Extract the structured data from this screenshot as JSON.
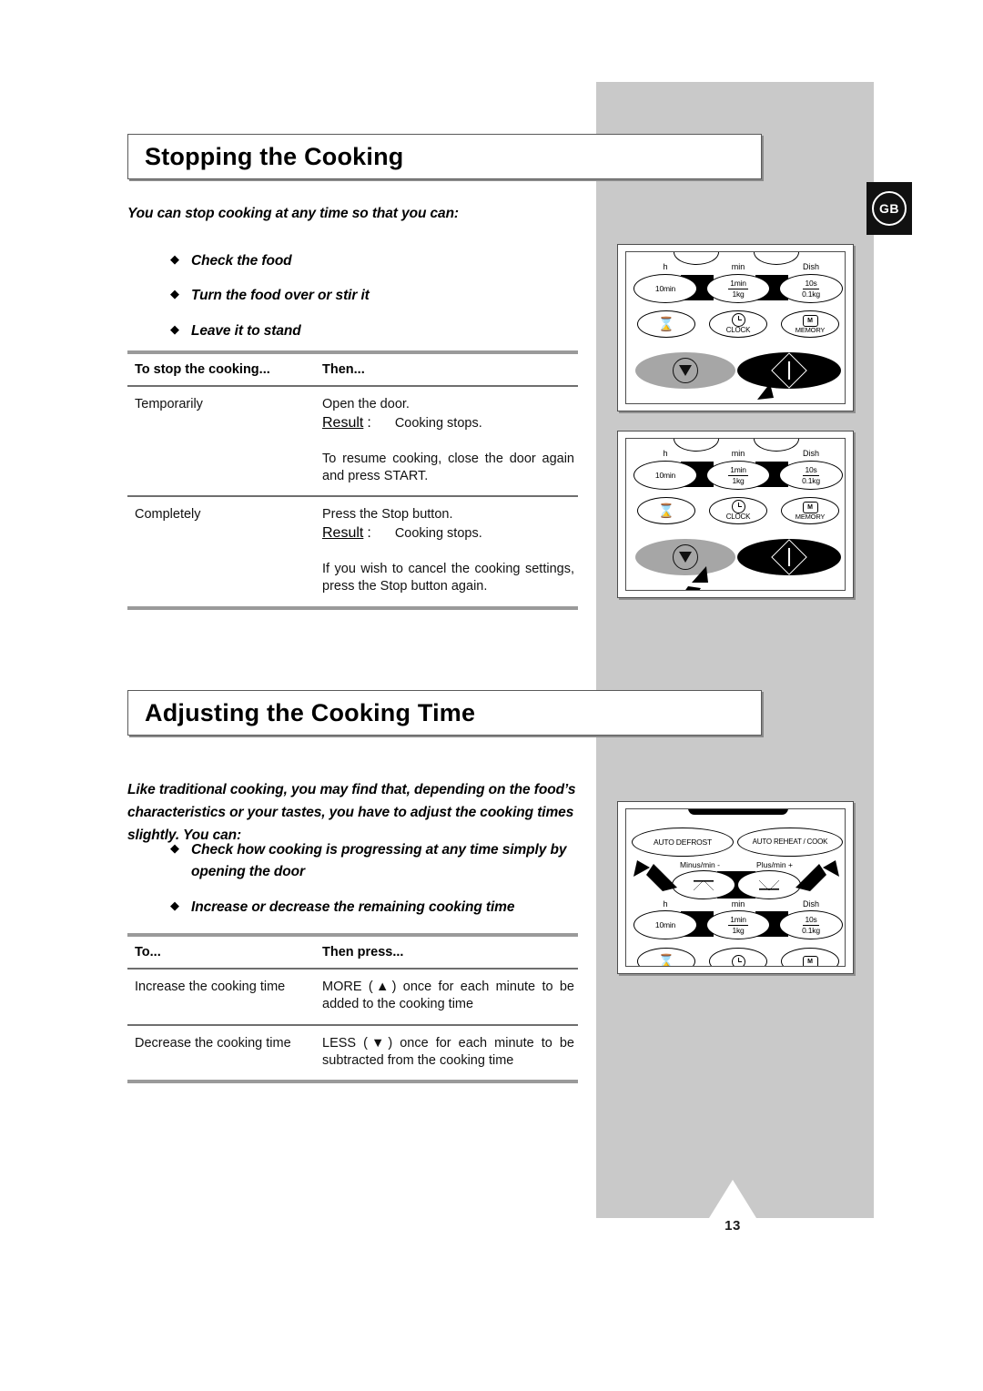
{
  "document": {
    "language_badge": "GB",
    "page_number": "13"
  },
  "sections": [
    {
      "id": "stopping",
      "title": "Stopping the Cooking",
      "intro": "You can stop cooking at any time so that you can:",
      "bullets": [
        "Check the food",
        "Turn the food over or stir it",
        "Leave it to stand"
      ],
      "table": {
        "headers": [
          "To stop the cooking...",
          "Then..."
        ],
        "rows": [
          {
            "col_a": "Temporarily",
            "line1": "Open the door.",
            "result_label": "Result",
            "result_value": "Cooking stops.",
            "note": "To resume cooking, close the door again and press START."
          },
          {
            "col_a": "Completely",
            "line1": "Press the Stop button.",
            "result_label": "Result",
            "result_value": "Cooking stops.",
            "note": "If you wish to cancel the cooking settings, press the Stop button again."
          }
        ]
      }
    },
    {
      "id": "adjusting",
      "title": "Adjusting the Cooking Time",
      "intro": "Like traditional cooking, you may find that, depending on the food’s characteristics or your tastes, you have to adjust the cooking times slightly. You can:",
      "bullets": [
        "Check how cooking is progressing at any time simply by opening the door",
        "Increase or decrease the remaining cooking time"
      ],
      "table": {
        "headers": [
          "To...",
          "Then press..."
        ],
        "rows": [
          {
            "col_a": "Increase the cooking time",
            "col_b": "MORE (▲) once for each minute to be added to the cooking time"
          },
          {
            "col_a": "Decrease the cooking time",
            "col_b": "LESS (▼) once for each minute to be subtracted from the cooking time"
          }
        ]
      }
    }
  ],
  "control_panels": [
    {
      "id": "panel-start-highlighted",
      "column_labels": [
        "h",
        "min",
        "Dish"
      ],
      "time_keys": [
        {
          "top": "10min",
          "bottom": ""
        },
        {
          "top": "1min",
          "bottom": "1kg"
        },
        {
          "top": "10s",
          "bottom": "0.1kg"
        }
      ],
      "function_keys": [
        "timer",
        "CLOCK",
        "MEMORY"
      ],
      "action_keys": [
        "stop",
        "start"
      ],
      "highlighted_key": "start"
    },
    {
      "id": "panel-stop-highlighted",
      "column_labels": [
        "h",
        "min",
        "Dish"
      ],
      "time_keys": [
        {
          "top": "10min",
          "bottom": ""
        },
        {
          "top": "1min",
          "bottom": "1kg"
        },
        {
          "top": "10s",
          "bottom": "0.1kg"
        }
      ],
      "function_keys": [
        "timer",
        "CLOCK",
        "MEMORY"
      ],
      "action_keys": [
        "stop",
        "start"
      ],
      "highlighted_key": "stop"
    },
    {
      "id": "panel-more-less",
      "auto_keys": [
        "AUTO DEFROST",
        "AUTO REHEAT / COOK"
      ],
      "adjust_labels": [
        "Minus/min -",
        "Plus/min +"
      ],
      "column_labels": [
        "h",
        "min",
        "Dish"
      ],
      "time_keys": [
        {
          "top": "10min",
          "bottom": ""
        },
        {
          "top": "1min",
          "bottom": "1kg"
        },
        {
          "top": "10s",
          "bottom": "0.1kg"
        }
      ],
      "highlighted_key": "minus-and-plus"
    }
  ],
  "colors": {
    "band_grey": "#c9c9c9",
    "rule_thick": "#9a9a9a",
    "rule_thin": "#6e6e6e",
    "stop_key": "#a6a6a6",
    "start_key": "#000000"
  }
}
